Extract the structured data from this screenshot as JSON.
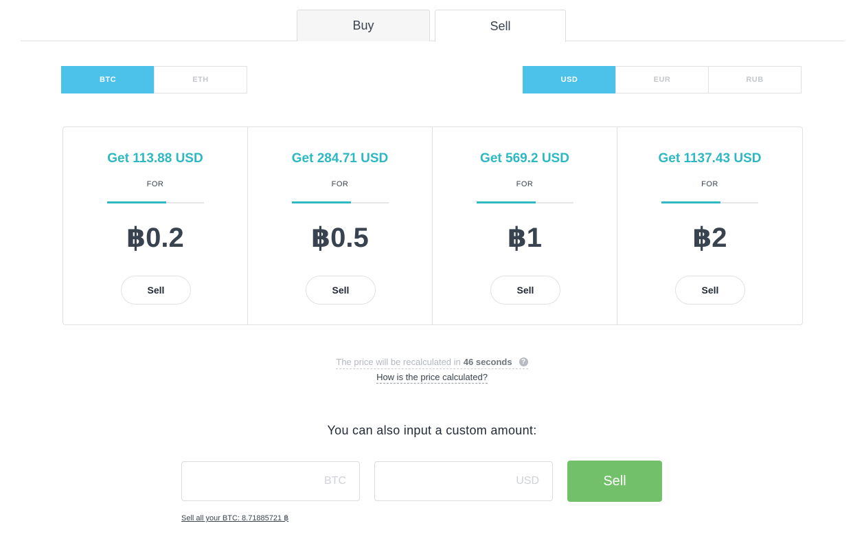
{
  "tabs": {
    "buy": "Buy",
    "sell": "Sell"
  },
  "crypto_toggle": [
    {
      "label": "BTC",
      "active": true
    },
    {
      "label": "ETH",
      "active": false
    }
  ],
  "fiat_toggle": [
    {
      "label": "USD",
      "active": true
    },
    {
      "label": "EUR",
      "active": false
    },
    {
      "label": "RUB",
      "active": false
    }
  ],
  "offers": [
    {
      "get": "Get 113.88 USD",
      "for": "FOR",
      "amount": "฿0.2",
      "button": "Sell"
    },
    {
      "get": "Get 284.71 USD",
      "for": "FOR",
      "amount": "฿0.5",
      "button": "Sell"
    },
    {
      "get": "Get 569.2 USD",
      "for": "FOR",
      "amount": "฿1",
      "button": "Sell"
    },
    {
      "get": "Get 1137.43 USD",
      "for": "FOR",
      "amount": "฿2",
      "button": "Sell"
    }
  ],
  "recalc": {
    "prefix": "The price will be recalculated in",
    "time": "46 seconds",
    "help_icon": "?"
  },
  "how_calculated": "How is the price calculated?",
  "custom": {
    "title": "You can also input a custom amount:",
    "btc_placeholder": "BTC",
    "usd_placeholder": "USD",
    "sell_button": "Sell",
    "sell_all": "Sell all your BTC: 8.71885721 ฿"
  },
  "colors": {
    "accent_blue": "#4cc2ea",
    "teal": "#2eb8c1",
    "sell_green": "#72c16a"
  }
}
